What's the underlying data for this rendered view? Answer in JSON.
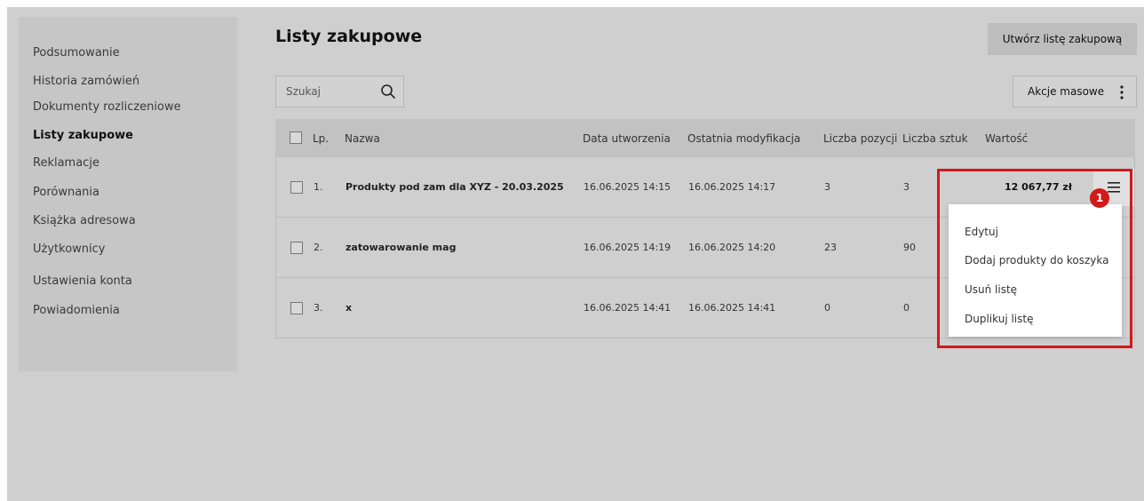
{
  "sidebar": {
    "items": [
      {
        "label": "Podsumowanie"
      },
      {
        "label": "Historia zamówień"
      },
      {
        "label": "Dokumenty rozliczeniowe"
      },
      {
        "label": "Listy zakupowe"
      },
      {
        "label": "Reklamacje"
      },
      {
        "label": "Porównania"
      },
      {
        "label": "Książka adresowa"
      },
      {
        "label": "Użytkownicy"
      },
      {
        "label": "Ustawienia konta"
      },
      {
        "label": "Powiadomienia"
      }
    ],
    "active": "Listy zakupowe"
  },
  "header": {
    "title": "Listy zakupowe",
    "create_button": "Utwórz listę zakupową"
  },
  "toolbar": {
    "search_placeholder": "Szukaj",
    "bulk_actions": "Akcje masowe"
  },
  "table": {
    "columns": [
      "Lp.",
      "Nazwa",
      "Data utworzenia",
      "Ostatnia modyfikacja",
      "Liczba pozycji",
      "Liczba sztuk",
      "Wartość"
    ],
    "rows": [
      {
        "lp": "1.",
        "name": "Produkty pod zam dla XYZ - 20.03.2025",
        "created": "16.06.2025 14:15",
        "modified": "16.06.2025 14:17",
        "positions": "3",
        "pieces": "3",
        "value": "12 067,77 zł"
      },
      {
        "lp": "2.",
        "name": "zatowarowanie mag",
        "created": "16.06.2025 14:19",
        "modified": "16.06.2025 14:20",
        "positions": "23",
        "pieces": "90",
        "value": ""
      },
      {
        "lp": "3.",
        "name": "x",
        "created": "16.06.2025 14:41",
        "modified": "16.06.2025 14:41",
        "positions": "0",
        "pieces": "0",
        "value": ""
      }
    ]
  },
  "row_menu": {
    "items": [
      "Edytuj",
      "Dodaj produkty do koszyka",
      "Usuń listę",
      "Duplikuj listę"
    ]
  },
  "annotation": {
    "badge": "1",
    "color": "#d11a1a"
  }
}
